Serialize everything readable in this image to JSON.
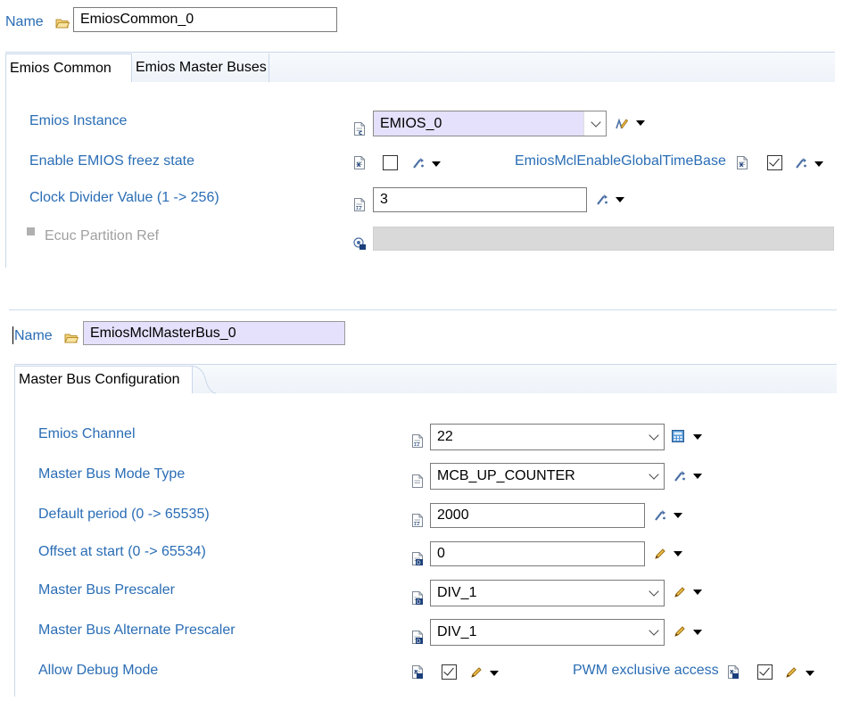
{
  "panel1": {
    "name_label": "Name",
    "name_value": "EmiosCommon_0",
    "tabs": [
      {
        "label": "Emios Common"
      },
      {
        "label": "Emios Master Buses"
      }
    ],
    "emios_instance": {
      "label": "Emios Instance",
      "value": "EMIOS_0"
    },
    "freeze_state": {
      "label": "Enable EMIOS freez state",
      "checked": false
    },
    "global_time_base": {
      "label": "EmiosMclEnableGlobalTimeBase",
      "checked": true
    },
    "clock_divider": {
      "label": "Clock Divider Value (1 -> 256)",
      "value": "3"
    },
    "partition_ref": {
      "label": "Ecuc Partition Ref",
      "value": ""
    }
  },
  "panel2": {
    "name_label": "Name",
    "name_value": "EmiosMclMasterBus_0",
    "tab": {
      "label": "Master Bus Configuration"
    },
    "channel": {
      "label": "Emios Channel",
      "value": "22"
    },
    "mode_type": {
      "label": "Master Bus Mode Type",
      "value": "MCB_UP_COUNTER"
    },
    "default_period": {
      "label": "Default period (0 -> 65535)",
      "value": "2000"
    },
    "offset_start": {
      "label": "Offset at start (0 -> 65534)",
      "value": "0"
    },
    "prescaler": {
      "label": "Master Bus Prescaler",
      "value": "DIV_1"
    },
    "alt_prescaler": {
      "label": "Master Bus Alternate Prescaler",
      "value": "DIV_1"
    },
    "debug_mode": {
      "label": "Allow Debug Mode",
      "checked": true
    },
    "pwm_exclusive": {
      "label": "PWM exclusive access",
      "checked": true
    }
  },
  "colors": {
    "label": "#2a6db5",
    "selected_field": "#e5e0fb",
    "tab_border": "#c9d8ea"
  }
}
